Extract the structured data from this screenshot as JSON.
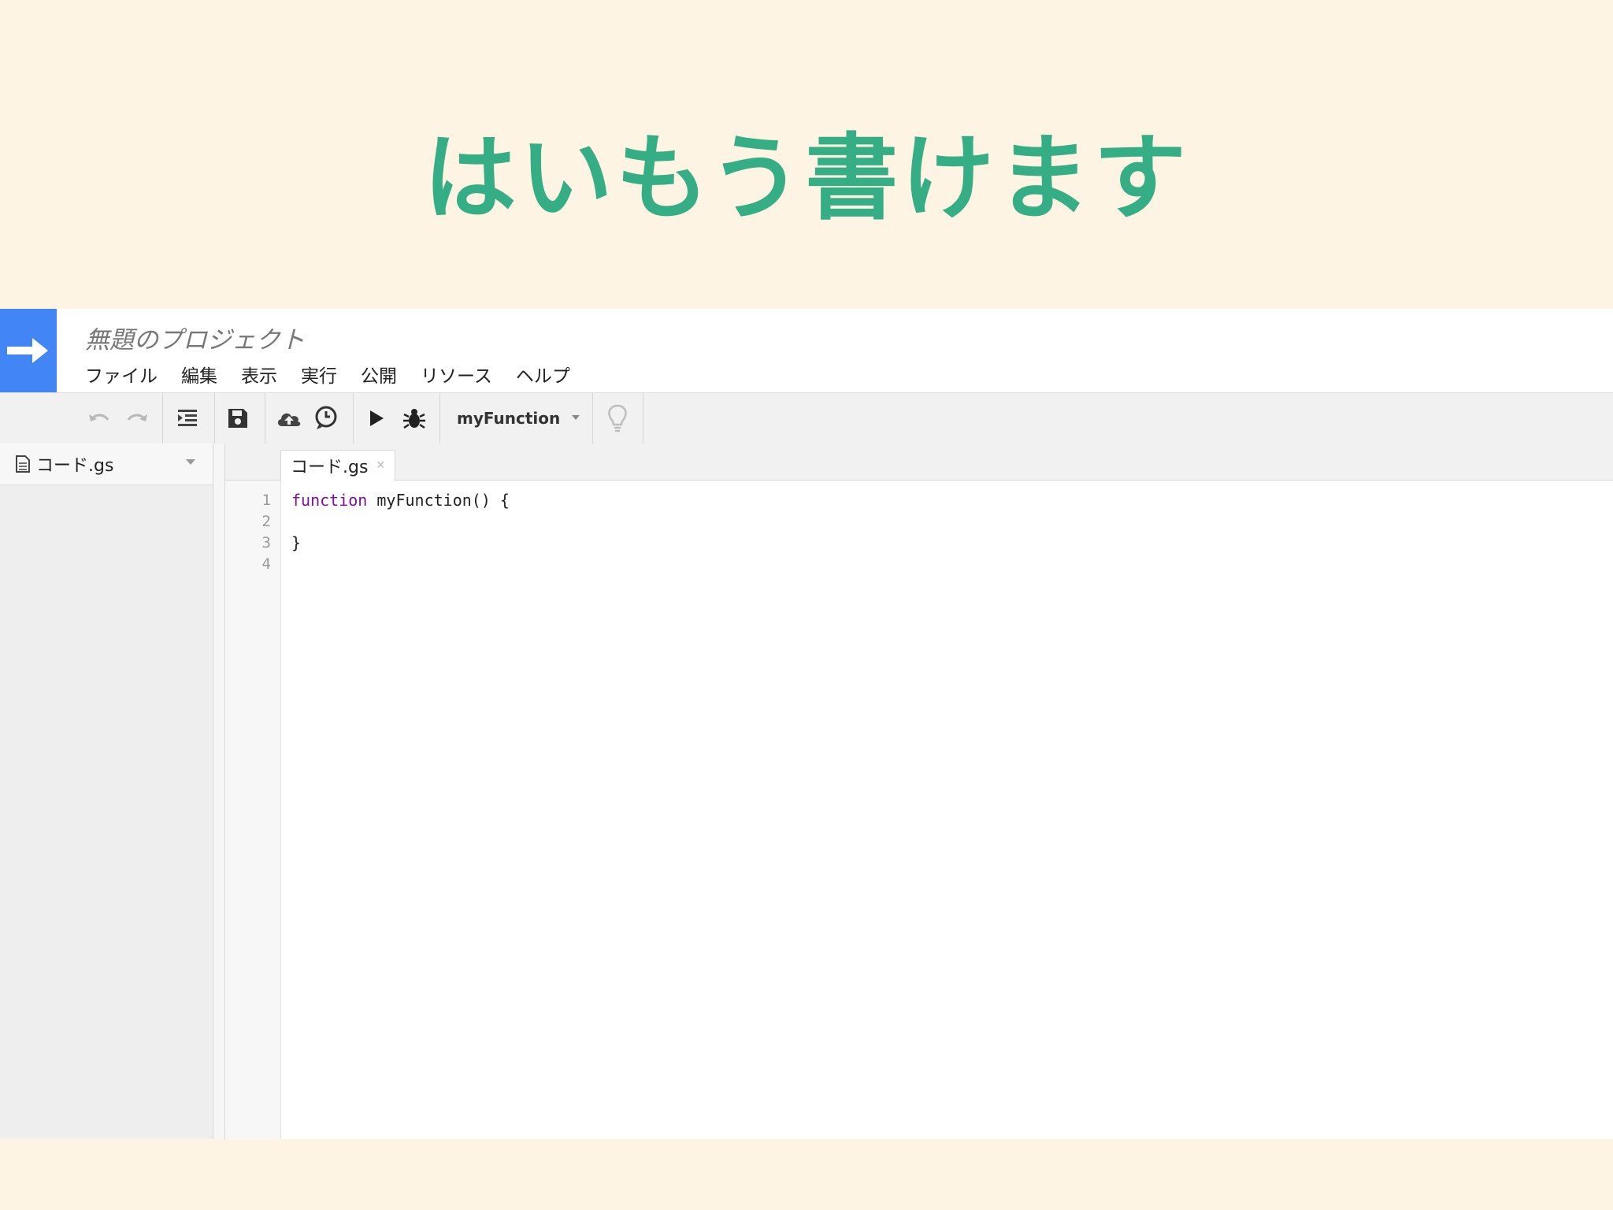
{
  "slide": {
    "title": "はいもう書けます"
  },
  "app": {
    "project_title": "無題のプロジェクト",
    "menu": [
      "ファイル",
      "編集",
      "表示",
      "実行",
      "公開",
      "リソース",
      "ヘルプ"
    ],
    "toolbar": {
      "function_select": "myFunction"
    },
    "sidebar": {
      "files": [
        {
          "name": "コード.gs"
        }
      ]
    },
    "editor": {
      "tab_label": "コード.gs",
      "line_numbers": [
        "1",
        "2",
        "3",
        "4"
      ],
      "code": {
        "keyword": "function",
        "line1_rest": " myFunction() {",
        "line3": "}"
      }
    }
  },
  "colors": {
    "title_green": "#35ad85",
    "logo_blue": "#4285f4",
    "keyword_purple": "#7f0f9c",
    "background": "#fdf4e3"
  }
}
